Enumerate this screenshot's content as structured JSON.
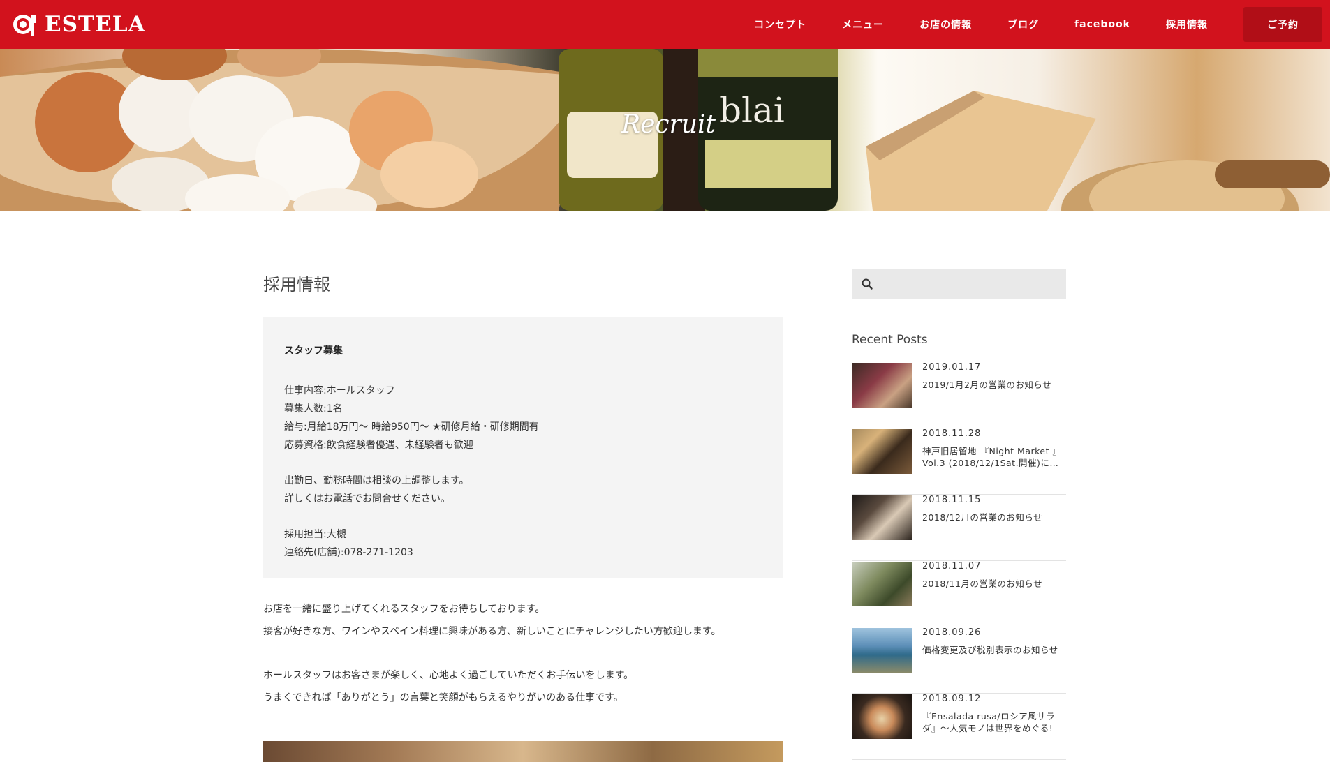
{
  "header": {
    "logo_text": "ESTELA",
    "brand_color": "#d2121d",
    "nav": [
      {
        "label": "コンセプト"
      },
      {
        "label": "メニュー"
      },
      {
        "label": "お店の情報"
      },
      {
        "label": "ブログ"
      },
      {
        "label": "facebook"
      },
      {
        "label": "採用情報"
      }
    ],
    "reserve_label": "ご予約"
  },
  "hero": {
    "title": "Recruit"
  },
  "main": {
    "page_title": "採用情報",
    "job": {
      "heading": "スタッフ募集",
      "details": [
        "仕事内容:ホールスタッフ",
        "募集人数:1名",
        "給与:月給18万円〜 時給950円〜 ★研修月給・研修期間有",
        "応募資格:飲食経験者優遇、未経験者も歓迎"
      ],
      "notes": [
        "出勤日、勤務時間は相談の上調整します。",
        "詳しくはお電話でお問合せください。"
      ],
      "contact": [
        "採用担当:大槻",
        "連絡先(店舗):078-271-1203"
      ]
    },
    "paragraphs": [
      [
        "お店を一緒に盛り上げてくれるスタッフをお待ちしております。",
        "接客が好きな方、ワインやスペイン料理に興味がある方、新しいことにチャレンジしたい方歓迎します。"
      ],
      [
        "ホールスタッフはお客さまが楽しく、心地よく過ごしていただくお手伝いをします。",
        "うまくできれば「ありがとう」の言葉と笑顔がもらえるやりがいのある仕事です。"
      ]
    ]
  },
  "sidebar": {
    "search": {
      "placeholder": "",
      "icon": "search-icon"
    },
    "recent_heading": "Recent Posts",
    "posts": [
      {
        "date": "2019.01.17",
        "title": "2019/1月2月の営業のお知らせ"
      },
      {
        "date": "2018.11.28",
        "title": "神戸旧居留地 『Night Market 』Vol.3 (2018/12/1Sat.開催)に…"
      },
      {
        "date": "2018.11.15",
        "title": "2018/12月の営業のお知らせ"
      },
      {
        "date": "2018.11.07",
        "title": "2018/11月の営業のお知らせ"
      },
      {
        "date": "2018.09.26",
        "title": "価格変更及び税別表示のお知らせ"
      },
      {
        "date": "2018.09.12",
        "title": "『Ensalada rusa/ロシア風サラダ』〜人気モノは世界をめぐる!"
      }
    ]
  }
}
